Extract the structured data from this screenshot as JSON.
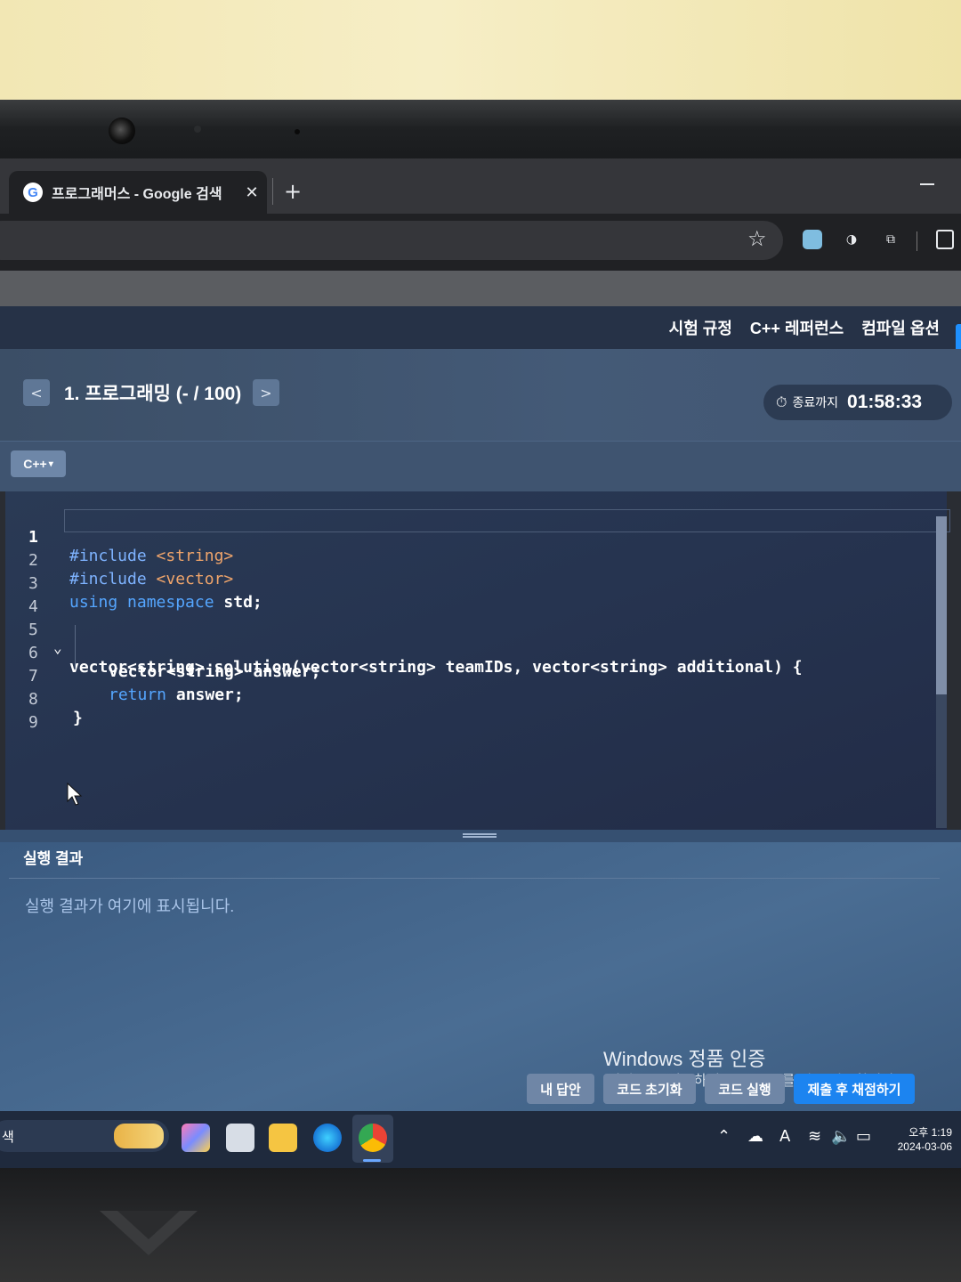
{
  "browser": {
    "tab_title": "프로그래머스 - Google 검색",
    "tab_close": "✕",
    "new_tab": "+"
  },
  "header": {
    "links": [
      "시험 규정",
      "C++ 레퍼런스",
      "컴파일 옵션"
    ]
  },
  "problem": {
    "prev": "<",
    "next": ">",
    "title": "1. 프로그래밍 (- / 100)",
    "timer_label": "종료까지",
    "timer_value": "01:58:33"
  },
  "editor": {
    "language": "C++",
    "lines": [
      {
        "n": "1"
      },
      {
        "n": "2"
      },
      {
        "n": "3"
      },
      {
        "n": "4"
      },
      {
        "n": "5"
      },
      {
        "n": "6"
      },
      {
        "n": "7"
      },
      {
        "n": "8"
      },
      {
        "n": "9"
      }
    ],
    "code": {
      "l1_pre": "#include",
      "l1_inc": "<string>",
      "l2_pre": "#include",
      "l2_inc": "<vector>",
      "l3_kw1": "using",
      "l3_kw2": "namespace",
      "l3_rest": "std;",
      "l5": "vector<string> solution(vector<string> teamIDs, vector<string> additional) {",
      "l6": "vector<string> answer;",
      "l7_kw": "return",
      "l7_rest": "answer;",
      "l8": "}"
    }
  },
  "result": {
    "title": "실행 결과",
    "placeholder": "실행 결과가 여기에 표시됩니다."
  },
  "watermark": {
    "title": "Windows 정품 인증",
    "subtitle": "[설정]으로 이동하여 Windows를 정품 인증합니다."
  },
  "actions": {
    "my_answer": "내 답안",
    "reset": "코드 초기화",
    "run": "코드 실행",
    "submit": "제출 후 채점하기"
  },
  "taskbar": {
    "search": "색",
    "tray_font": "A",
    "time": "오후 1:19",
    "date": "2024-03-06"
  },
  "colors": {
    "accent": "#1c84f0",
    "editor_bg": "#263450",
    "result_bg": "#4a6d93"
  }
}
